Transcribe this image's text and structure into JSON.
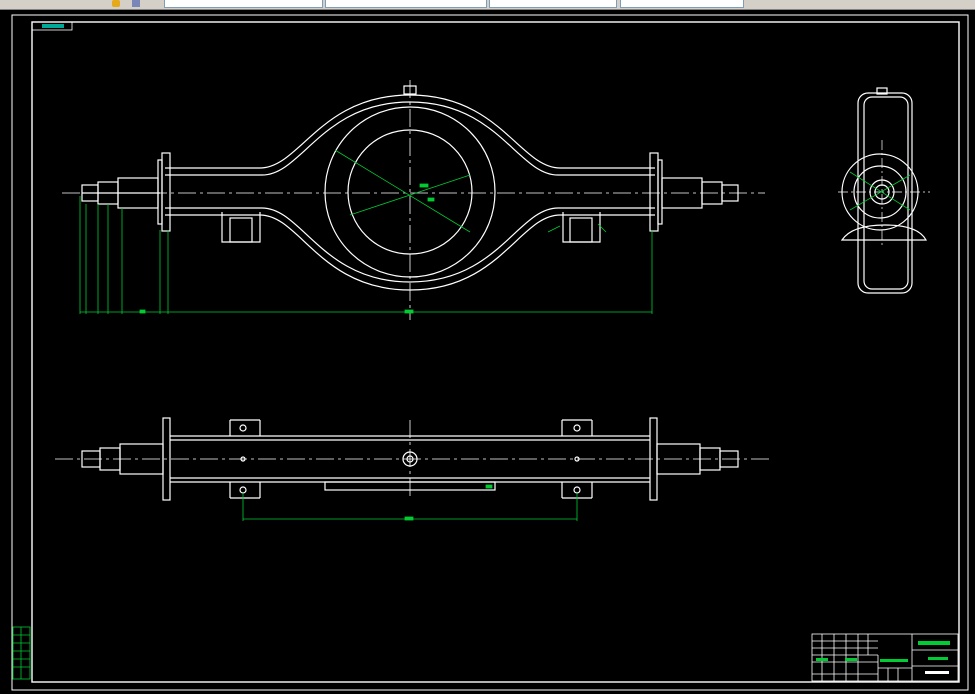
{
  "toolbar": {
    "fields": [
      "",
      "",
      "",
      ""
    ],
    "active_field_label": "",
    "icons": [
      "folder-icon",
      "layer-icon"
    ]
  },
  "drawing": {
    "title_tag": "",
    "title_block": {
      "name_label": "",
      "part_code": "",
      "drawing_no": ""
    },
    "dimension_value": ""
  },
  "colors": {
    "background": "#000000",
    "geometry": "#ffffff",
    "dimension": "#00cc33",
    "frame": "#ffffff"
  }
}
